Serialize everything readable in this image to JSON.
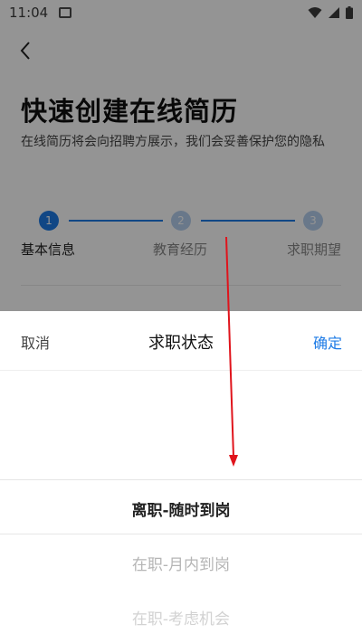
{
  "status_bar": {
    "time": "11:04"
  },
  "page": {
    "title": "快速创建在线简历",
    "subtitle": "在线简历将会向招聘方展示，我们会妥善保护您的隐私",
    "steps": [
      {
        "number": "1",
        "label": "基本信息",
        "state": "active"
      },
      {
        "number": "2",
        "label": "教育经历",
        "state": "inactive"
      },
      {
        "number": "3",
        "label": "求职期望",
        "state": "inactive"
      }
    ]
  },
  "sheet": {
    "cancel_label": "取消",
    "title": "求职状态",
    "confirm_label": "确定",
    "options": [
      "离职-随时到岗",
      "在职-月内到岗",
      "在职-考虑机会"
    ],
    "selected_option": "离职-随时到岗"
  },
  "colors": {
    "accent": "#1e7be6",
    "annotation_arrow": "#e0141c"
  }
}
